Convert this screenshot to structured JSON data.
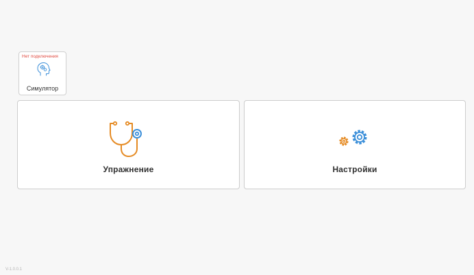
{
  "simulator": {
    "status": "Нет подключения",
    "label": "Симулятор",
    "icon": "head-gears-icon",
    "status_color": "#e0493f"
  },
  "cards": {
    "exercise": {
      "label": "Упражнение",
      "icon": "stethoscope-icon"
    },
    "settings": {
      "label": "Настройки",
      "icon": "gears-icon"
    }
  },
  "version": "V-1.0.0.1",
  "colors": {
    "background": "#f7f7f7",
    "icon_orange": "#e58a22",
    "icon_blue": "#3b8fd9",
    "status_red": "#e0493f"
  }
}
